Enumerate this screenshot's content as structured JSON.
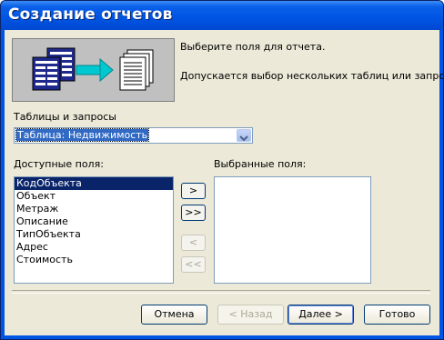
{
  "window": {
    "title": "Создание отчетов"
  },
  "banner": {
    "prompt": "Выберите поля для отчета.",
    "hint": "Допускается выбор нескольких таблиц или запросов."
  },
  "source": {
    "label": "Таблицы и запросы",
    "selected": "Таблица: Недвижимость"
  },
  "available": {
    "label": "Доступные поля:",
    "items": [
      "КодОбъекта",
      "Объект",
      "Метраж",
      "Описание",
      "ТипОбъекта",
      "Адрес",
      "Стоимость"
    ],
    "selected_index": 0
  },
  "chosen": {
    "label": "Выбранные поля:",
    "items": []
  },
  "move_buttons": {
    "add_one": ">",
    "add_all": ">>",
    "remove_one": "<",
    "remove_all": "<<"
  },
  "footer": {
    "cancel": "Отмена",
    "back": "< Назад",
    "next": "Далее >",
    "finish": "Готово"
  },
  "colors": {
    "title_bar": "#0054e3",
    "dialog_bg": "#ece9d8",
    "selection": "#0a246a",
    "arrow_accent": "#00c8d0"
  }
}
